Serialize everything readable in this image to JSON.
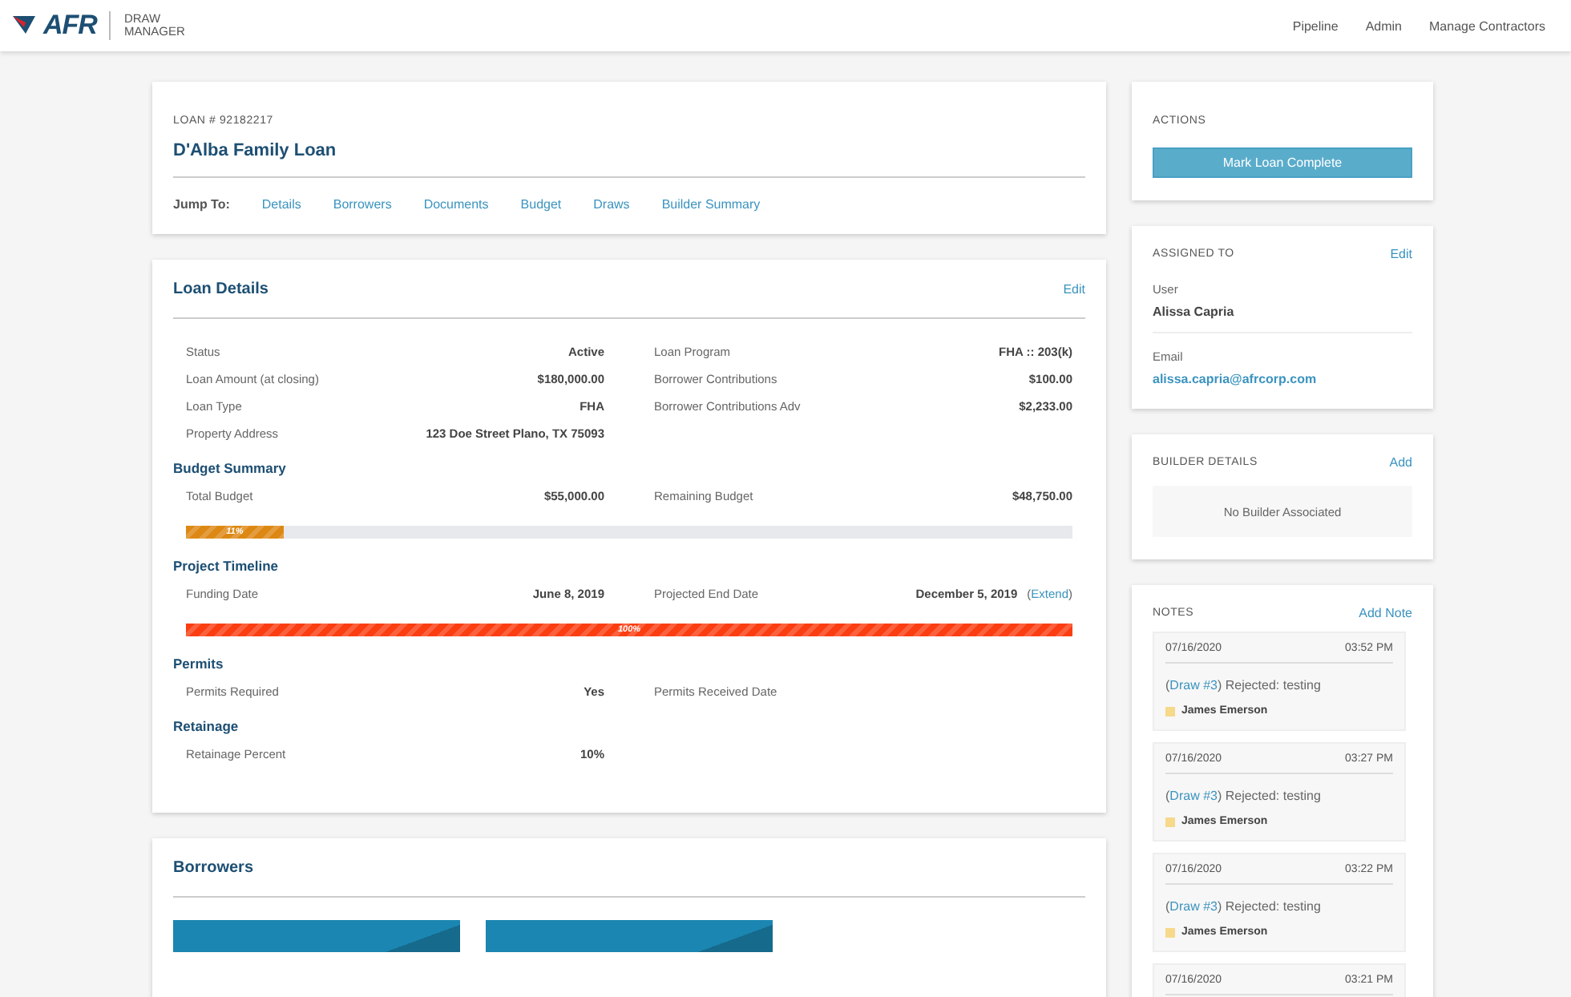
{
  "header": {
    "logo": {
      "text": "AFR",
      "product_lines": [
        "DRAW",
        "MANAGER"
      ]
    },
    "nav": [
      {
        "label": "Pipeline"
      },
      {
        "label": "Admin"
      },
      {
        "label": "Manage Contractors"
      }
    ]
  },
  "loan": {
    "number": "LOAN # 92182217",
    "title": "D'Alba Family Loan",
    "jump_label": "Jump To:",
    "jump_links": [
      {
        "label": "Details"
      },
      {
        "label": "Borrowers"
      },
      {
        "label": "Documents"
      },
      {
        "label": "Budget"
      },
      {
        "label": "Draws"
      },
      {
        "label": "Builder Summary"
      }
    ]
  },
  "loan_details": {
    "title": "Loan Details",
    "edit": "Edit",
    "sections": [
      {
        "fields": [
          {
            "label": "Status",
            "value": "Active"
          },
          {
            "label": "Loan Program",
            "value": "FHA :: 203(k)"
          },
          {
            "label": "Loan Amount (at closing)",
            "value": "$180,000.00"
          },
          {
            "label": "Borrower Contributions",
            "value": "$100.00"
          },
          {
            "label": "Loan Type",
            "value": "FHA"
          },
          {
            "label": "Borrower Contributions Adv",
            "value": "$2,233.00"
          },
          {
            "label": "Property Address",
            "value": "123 Doe Street Plano, TX 75093"
          }
        ]
      },
      {
        "title": "Budget Summary",
        "fields": [
          {
            "label": "Total Budget",
            "value": "$55,000.00"
          },
          {
            "label": "Remaining Budget",
            "value": "$48,750.00"
          }
        ],
        "progress": {
          "kind": "warning",
          "level": 0.11,
          "label": "11%"
        }
      },
      {
        "title": "Project Timeline",
        "fields": [
          {
            "label": "Funding Date",
            "value": "June 8, 2019"
          },
          {
            "label": "Projected End Date",
            "value": "December 5, 2019",
            "extend": {
              "before": "(",
              "link": "Extend",
              "after": ")"
            }
          }
        ],
        "progress": {
          "kind": "danger",
          "level": 1,
          "label": "100%"
        }
      },
      {
        "title": "Permits",
        "fields": [
          {
            "label": "Permits Required",
            "value": "Yes"
          },
          {
            "label": "Permits Received Date"
          }
        ]
      },
      {
        "title": "Retainage",
        "fields": [
          {
            "label": "Retainage Percent",
            "value": "10%"
          }
        ]
      }
    ]
  },
  "borrowers": {
    "title": "Borrowers",
    "cards": [
      {
        "kind": "borrower"
      },
      {
        "kind": "borrower"
      }
    ]
  },
  "actions": {
    "title": "ACTIONS",
    "button": "Mark Loan Complete"
  },
  "assigned": {
    "title": "ASSIGNED TO",
    "edit": "Edit",
    "user_label": "User",
    "user": "Alissa Capria",
    "email_label": "Email",
    "email": "alissa.capria@afrcorp.com"
  },
  "builder": {
    "title": "BUILDER DETAILS",
    "add": "Add",
    "empty": "No Builder Associated"
  },
  "notes": {
    "title": "NOTES",
    "add": "Add Note",
    "items": [
      {
        "date": "07/16/2020",
        "time": "03:52 PM",
        "before": "(",
        "link": "Draw #3",
        "after": ") Rejected: testing",
        "author": "James Emerson"
      },
      {
        "date": "07/16/2020",
        "time": "03:27 PM",
        "before": "(",
        "link": "Draw #3",
        "after": ") Rejected: testing",
        "author": "James Emerson"
      },
      {
        "date": "07/16/2020",
        "time": "03:22 PM",
        "before": "(",
        "link": "Draw #3",
        "after": ") Rejected: testing",
        "author": "James Emerson"
      },
      {
        "date": "07/16/2020",
        "time": "03:21 PM"
      }
    ]
  }
}
